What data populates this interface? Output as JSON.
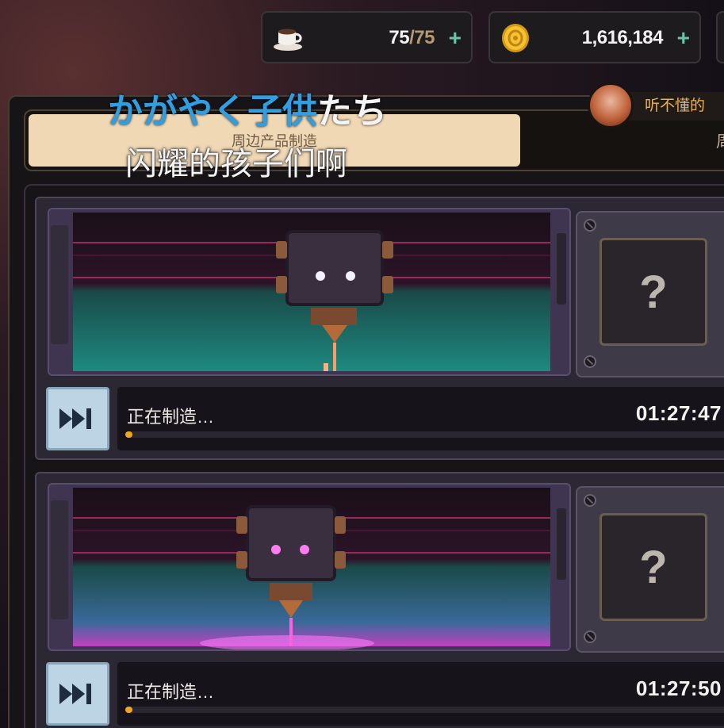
{
  "resources": {
    "stamina": {
      "icon": "coffee-cup-icon",
      "current": "75",
      "max": "/75",
      "plus": "+"
    },
    "coins": {
      "icon": "gold-coin-icon",
      "value": "1,616,184",
      "plus": "+"
    }
  },
  "tabs": [
    {
      "label": "周边产品制造",
      "active": true
    },
    {
      "label": "周",
      "active": false
    }
  ],
  "friend_chat": {
    "icon": "character-avatar-icon",
    "text": "听不懂的"
  },
  "slots": [
    {
      "status": "正在制造…",
      "timer": "01:27:47",
      "progress": 0.01,
      "result": "?",
      "skip_icon": "fast-forward-icon",
      "eye_color": "#f2f2ff",
      "beam_color": "#ff9a6a"
    },
    {
      "status": "正在制造…",
      "timer": "01:27:50",
      "progress": 0.01,
      "result": "?",
      "skip_icon": "fast-forward-icon",
      "eye_color": "#ff7cf0",
      "beam_color": "#ff60e0"
    }
  ],
  "subtitles": {
    "japanese_highlighted": "かがやく子供",
    "japanese_rest": "たち",
    "chinese": "闪耀的孩子们啊"
  },
  "colors": {
    "accent_plus": "#6cc2a7",
    "progress_fill": "#f0a824",
    "tab_active_bg": "#f0d8b5",
    "subtitle_highlight": "#2f9fe2"
  }
}
